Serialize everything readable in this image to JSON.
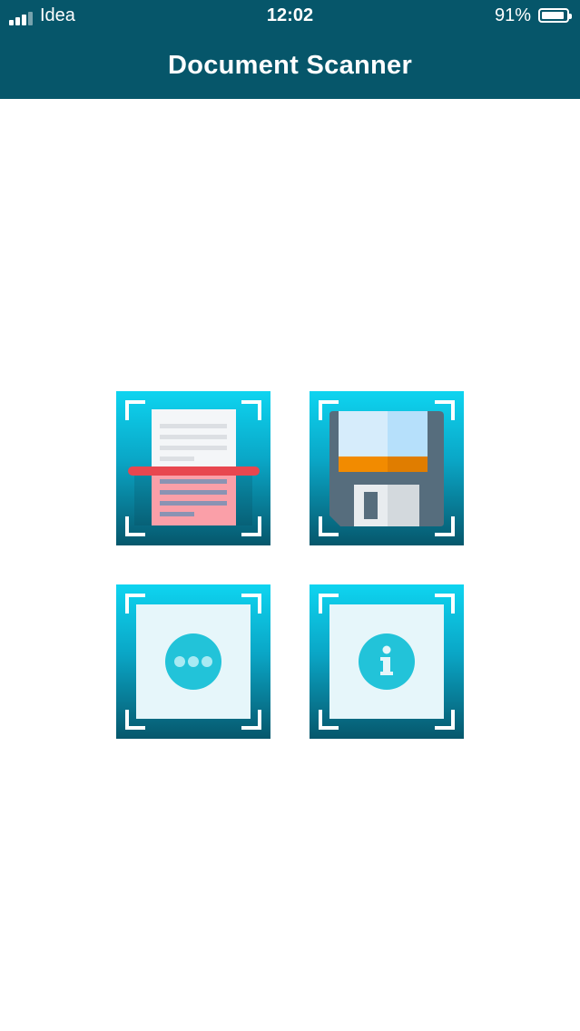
{
  "status_bar": {
    "carrier": "Idea",
    "time": "12:02",
    "battery_text": "91%",
    "battery_level": 0.91,
    "signal_bars": 4
  },
  "header": {
    "title": "Document Scanner"
  },
  "tiles": [
    {
      "id": "scan",
      "icon": "document-scan-icon"
    },
    {
      "id": "save",
      "icon": "floppy-disk-icon"
    },
    {
      "id": "more",
      "icon": "more-dots-icon"
    },
    {
      "id": "info",
      "icon": "info-icon"
    }
  ],
  "colors": {
    "header_bg": "#06566a",
    "tile_top": "#0ed4f0",
    "tile_bottom": "#06576c",
    "scan_line": "#e8474f",
    "floppy_orange": "#f28b00",
    "circle_accent": "#22c3d9"
  }
}
